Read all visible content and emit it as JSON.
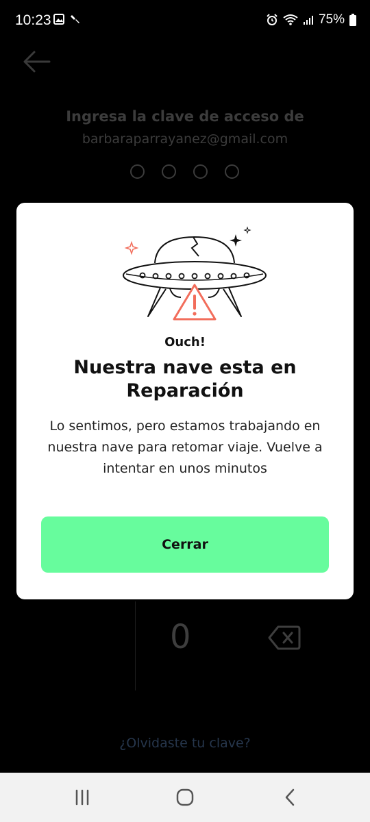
{
  "status_bar": {
    "time": "10:23",
    "battery": "75%",
    "icons_left": [
      "gallery-icon",
      "tools-icon"
    ],
    "icons_right": [
      "alarm-icon",
      "wifi-icon",
      "signal-icon",
      "battery-icon"
    ]
  },
  "background": {
    "title": "Ingresa la clave de acceso de",
    "email": "barbaraparrayanez@gmail.com",
    "pin_length": 4,
    "keypad_zero": "0",
    "forgot_link": "¿Olvidaste tu clave?"
  },
  "modal": {
    "kicker": "Ouch!",
    "title": "Nuestra nave esta en Reparación",
    "body": "Lo sentimos, pero estamos trabajando en nuestra nave para retomar viaje. Vuelve a intentar en unos minutos",
    "close_label": "Cerrar",
    "illustration": "ufo-warning-illustration"
  },
  "nav_bar": {
    "buttons": [
      "recent-apps-icon",
      "home-icon",
      "back-icon"
    ]
  },
  "colors": {
    "accent_button": "#67fc9d",
    "warning": "#f26d5b",
    "modal_bg": "#ffffff",
    "screen_bg": "#000000"
  }
}
